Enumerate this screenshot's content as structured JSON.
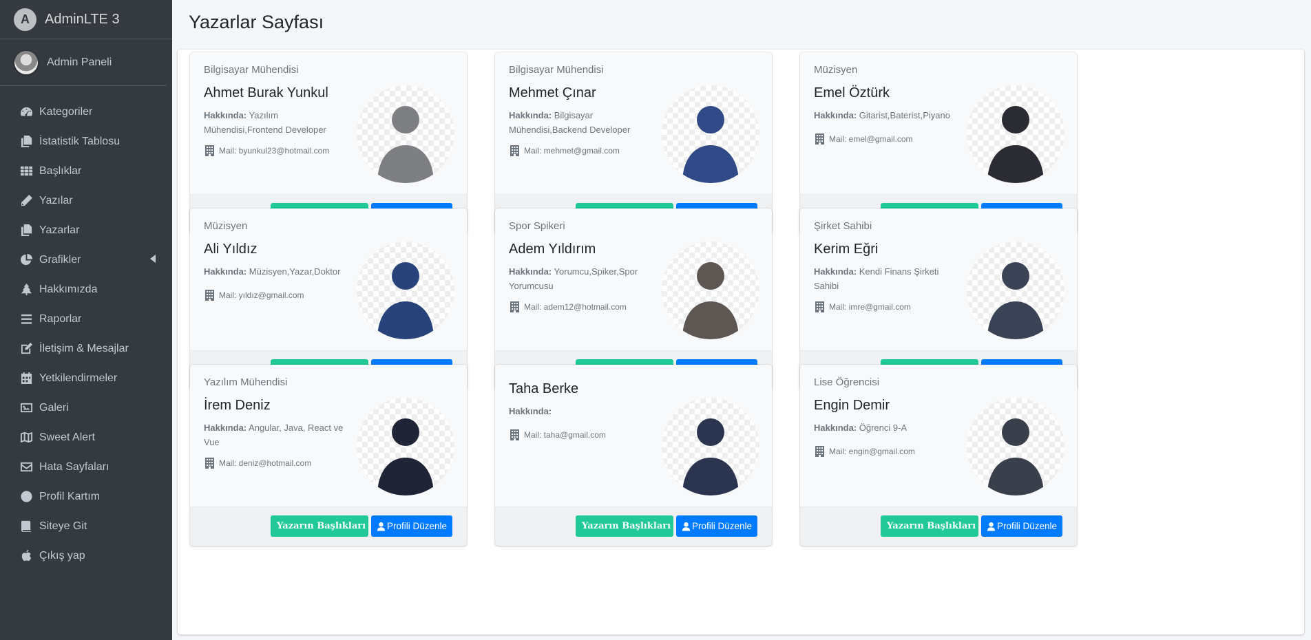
{
  "brand": {
    "logo_letter": "A",
    "name": "AdminLTE 3"
  },
  "user": {
    "name": "Admin Paneli"
  },
  "nav": [
    {
      "label": "Kategoriler",
      "icon": "dashboard-icon"
    },
    {
      "label": "İstatistik Tablosu",
      "icon": "copy-icon"
    },
    {
      "label": "Başlıklar",
      "icon": "grid-icon"
    },
    {
      "label": "Yazılar",
      "icon": "pencil-icon"
    },
    {
      "label": "Yazarlar",
      "icon": "copy-icon"
    },
    {
      "label": "Grafikler",
      "icon": "pie-chart-icon"
    },
    {
      "label": "Hakkımızda",
      "icon": "tree-icon"
    },
    {
      "label": "Raporlar",
      "icon": "list-icon"
    },
    {
      "label": "İletişim & Mesajlar",
      "icon": "edit-icon"
    },
    {
      "label": "Yetkilendirmeler",
      "icon": "calendar-icon"
    },
    {
      "label": "Galeri",
      "icon": "image-icon"
    },
    {
      "label": "Sweet Alert",
      "icon": "map-icon"
    },
    {
      "label": "Hata Sayfaları",
      "icon": "envelope-icon"
    },
    {
      "label": "Profil Kartım",
      "icon": "circle-icon"
    },
    {
      "label": "Siteye Git",
      "icon": "book-icon"
    },
    {
      "label": "Çıkış yap",
      "icon": "apple-icon"
    }
  ],
  "page": {
    "title": "Yazarlar Sayfası"
  },
  "labels": {
    "about": "Hakkında:",
    "mail_prefix": "Mail: "
  },
  "buttons": {
    "titles": "Yazarın Başlıkları",
    "edit": "Profili Düzenle"
  },
  "colors": {
    "sidebar": "#343a40",
    "teal": "#20c997",
    "blue": "#007bff"
  },
  "authors": [
    {
      "profession": "Bilgisayar Mühendisi",
      "name": "Ahmet Burak Yunkul",
      "about": "Yazılım Mühendisi,Frontend Developer",
      "mail": "Mail: byunkul23@hotmail.com"
    },
    {
      "profession": "Bilgisayar Mühendisi",
      "name": "Mehmet Çınar",
      "about": "Bilgisayar Mühendisi,Backend Developer",
      "mail": "Mail: mehmet@gmail.com"
    },
    {
      "profession": "Müzisyen",
      "name": "Emel Öztürk",
      "about": "Gitarist,Baterist,Piyano",
      "mail": "Mail: emel@gmail.com"
    },
    {
      "profession": "Müzisyen",
      "name": "Ali Yıldız",
      "about": "Müzisyen,Yazar,Doktor",
      "mail": "Mail: yıldız@gmail.com"
    },
    {
      "profession": "Spor Spikeri",
      "name": "Adem Yıldırım",
      "about": "Yorumcu,Spiker,Spor Yorumcusu",
      "mail": "Mail: adem12@hotmail.com"
    },
    {
      "profession": "Şirket Sahibi",
      "name": "Kerim Eğri",
      "about": "Kendi Finans Şirketi Sahibi",
      "mail": "Mail: imre@gmail.com"
    },
    {
      "profession": "Yazılım Mühendisi",
      "name": "İrem Deniz",
      "about": "Angular, Java, React ve Vue",
      "mail": "Mail: deniz@hotmail.com"
    },
    {
      "profession": "",
      "name": "Taha Berke",
      "about": "",
      "mail": "Mail: taha@gmail.com"
    },
    {
      "profession": "Lise Öğrencisi",
      "name": "Engin Demir",
      "about": "Öğrenci 9-A",
      "mail": "Mail: engin@gmail.com"
    }
  ]
}
